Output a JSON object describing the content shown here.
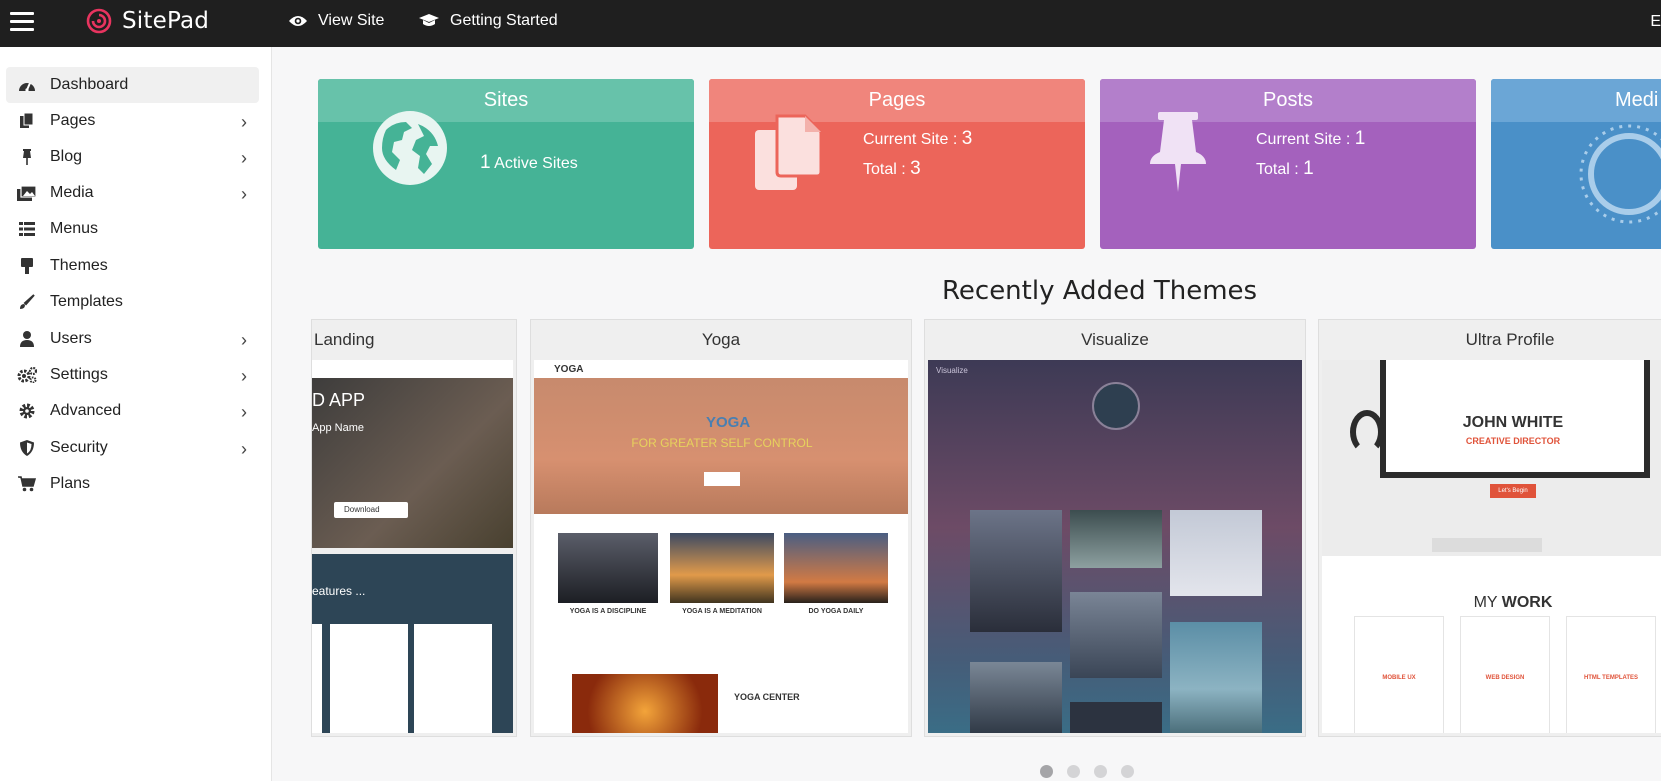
{
  "app": {
    "name": "SitePad"
  },
  "topbar": {
    "view_site": "View Site",
    "getting_started": "Getting Started",
    "right_text": "E"
  },
  "sidebar": {
    "items": [
      {
        "label": "Dashboard",
        "icon": "dashboard-icon",
        "arrow": false,
        "active": true
      },
      {
        "label": "Pages",
        "icon": "pages-icon",
        "arrow": true
      },
      {
        "label": "Blog",
        "icon": "pin-icon",
        "arrow": true
      },
      {
        "label": "Media",
        "icon": "media-icon",
        "arrow": true
      },
      {
        "label": "Menus",
        "icon": "menus-icon",
        "arrow": false
      },
      {
        "label": "Themes",
        "icon": "themes-icon",
        "arrow": false
      },
      {
        "label": "Templates",
        "icon": "brush-icon",
        "arrow": false
      },
      {
        "label": "Users",
        "icon": "user-icon",
        "arrow": true
      },
      {
        "label": "Settings",
        "icon": "settings-icon",
        "arrow": true
      },
      {
        "label": "Advanced",
        "icon": "gear-icon",
        "arrow": true
      },
      {
        "label": "Security",
        "icon": "shield-icon",
        "arrow": true
      },
      {
        "label": "Plans",
        "icon": "cart-icon",
        "arrow": false
      }
    ]
  },
  "cards": {
    "sites": {
      "title": "Sites",
      "count": "1",
      "label": "Active Sites",
      "color": "#45b396"
    },
    "pages": {
      "title": "Pages",
      "current_label": "Current Site :",
      "current": "3",
      "total_label": "Total :",
      "total": "3",
      "color": "#ec655a"
    },
    "posts": {
      "title": "Posts",
      "current_label": "Current Site :",
      "current": "1",
      "total_label": "Total :",
      "total": "1",
      "color": "#a461bd"
    },
    "media": {
      "title": "Medi",
      "color": "#4a90c8"
    }
  },
  "themes_section": {
    "title": "Recently Added Themes",
    "themes": [
      {
        "name": "Landing"
      },
      {
        "name": "Yoga"
      },
      {
        "name": "Visualize"
      },
      {
        "name": "Ultra Profile"
      }
    ],
    "carousel_pages": 4,
    "active_page": 1
  },
  "previews": {
    "landing": {
      "app": "D APP",
      "sub": "App Name",
      "features": "eatures ...",
      "download": "Download"
    },
    "yoga": {
      "logo": "YOGA",
      "hero": "YOGA",
      "tagline": "FOR GREATER SELF CONTROL",
      "cards": [
        "YOGA IS A DISCIPLINE",
        "YOGA IS A MEDITATION",
        "DO YOGA DAILY"
      ],
      "center": "YOGA CENTER"
    },
    "visualize": {
      "logo": "Visualize"
    },
    "ultra": {
      "name": "JOHN WHITE",
      "role": "CREATIVE DIRECTOR",
      "btn": "Let's Begin",
      "work_a": "MY",
      "work_b": "WORK",
      "services": [
        "MOBILE UX",
        "WEB DESIGN",
        "HTML TEMPLATES"
      ]
    }
  }
}
